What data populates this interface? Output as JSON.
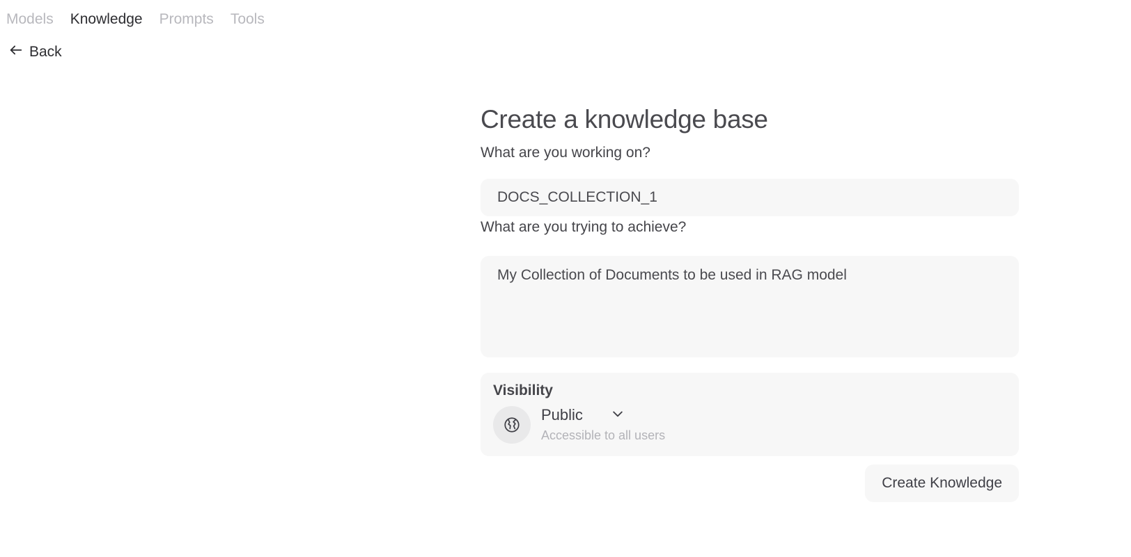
{
  "nav": {
    "tabs": [
      {
        "label": "Models",
        "active": false
      },
      {
        "label": "Knowledge",
        "active": true
      },
      {
        "label": "Prompts",
        "active": false
      },
      {
        "label": "Tools",
        "active": false
      }
    ],
    "back_label": "Back"
  },
  "form": {
    "title": "Create a knowledge base",
    "name_label": "What are you working on?",
    "name_value": "DOCS_COLLECTION_1",
    "description_label": "What are you trying to achieve?",
    "description_value": "My Collection of Documents to be used in RAG model",
    "visibility": {
      "title": "Visibility",
      "icon": "globe-icon",
      "selected": "Public",
      "subtitle": "Accessible to all users"
    },
    "submit_label": "Create Knowledge"
  },
  "colors": {
    "field_bg": "#f7f7f7",
    "text_primary": "#3f3f46",
    "text_muted": "#b8b8bd"
  }
}
